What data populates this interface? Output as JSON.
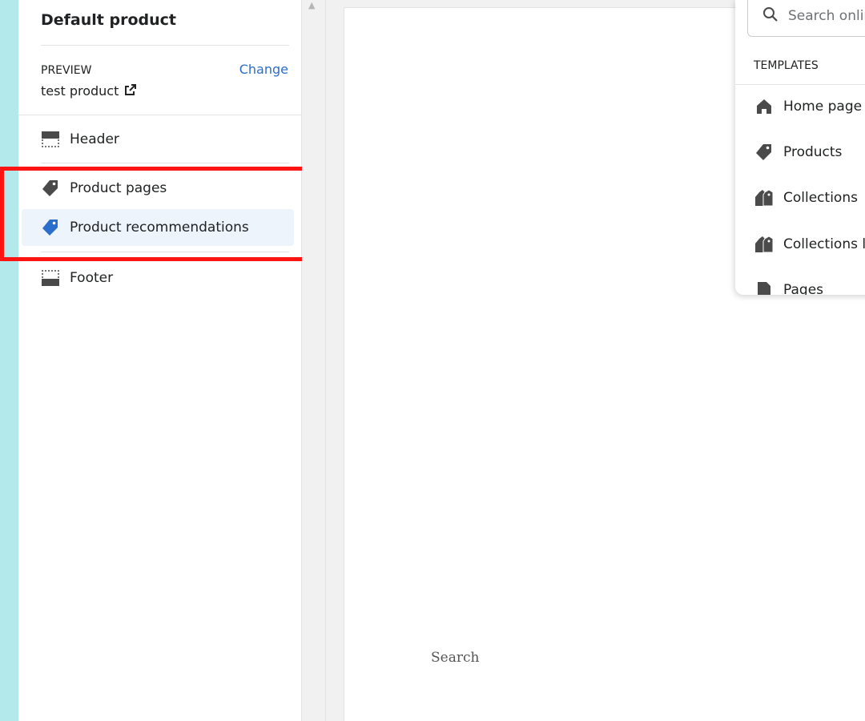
{
  "sidebar": {
    "template_title": "Default product",
    "preview": {
      "label": "PREVIEW",
      "change_label": "Change",
      "product_name": "test product"
    },
    "sections": [
      {
        "label": "Header",
        "icon": "header-layout-icon"
      },
      {
        "label": "Product pages",
        "icon": "tag-icon"
      },
      {
        "label": "Product recommendations",
        "icon": "tag-icon",
        "selected": true
      },
      {
        "label": "Footer",
        "icon": "footer-layout-icon"
      }
    ]
  },
  "preview": {
    "search_text": "Search"
  },
  "template_dropdown": {
    "search_placeholder": "Search online store",
    "heading": "TEMPLATES",
    "items": [
      {
        "label": "Home page",
        "icon": "home-icon"
      },
      {
        "label": "Products",
        "icon": "tag-icon"
      },
      {
        "label": "Collections",
        "icon": "collections-icon"
      },
      {
        "label": "Collections list",
        "icon": "collections-icon"
      },
      {
        "label": "Pages",
        "icon": "page-icon"
      }
    ]
  },
  "colors": {
    "accent_strip": "#b3e9ea",
    "link": "#2c6ecb",
    "selected_bg": "#eef4fb",
    "highlight": "#ff1414",
    "selected_icon": "#2c6ecb"
  }
}
